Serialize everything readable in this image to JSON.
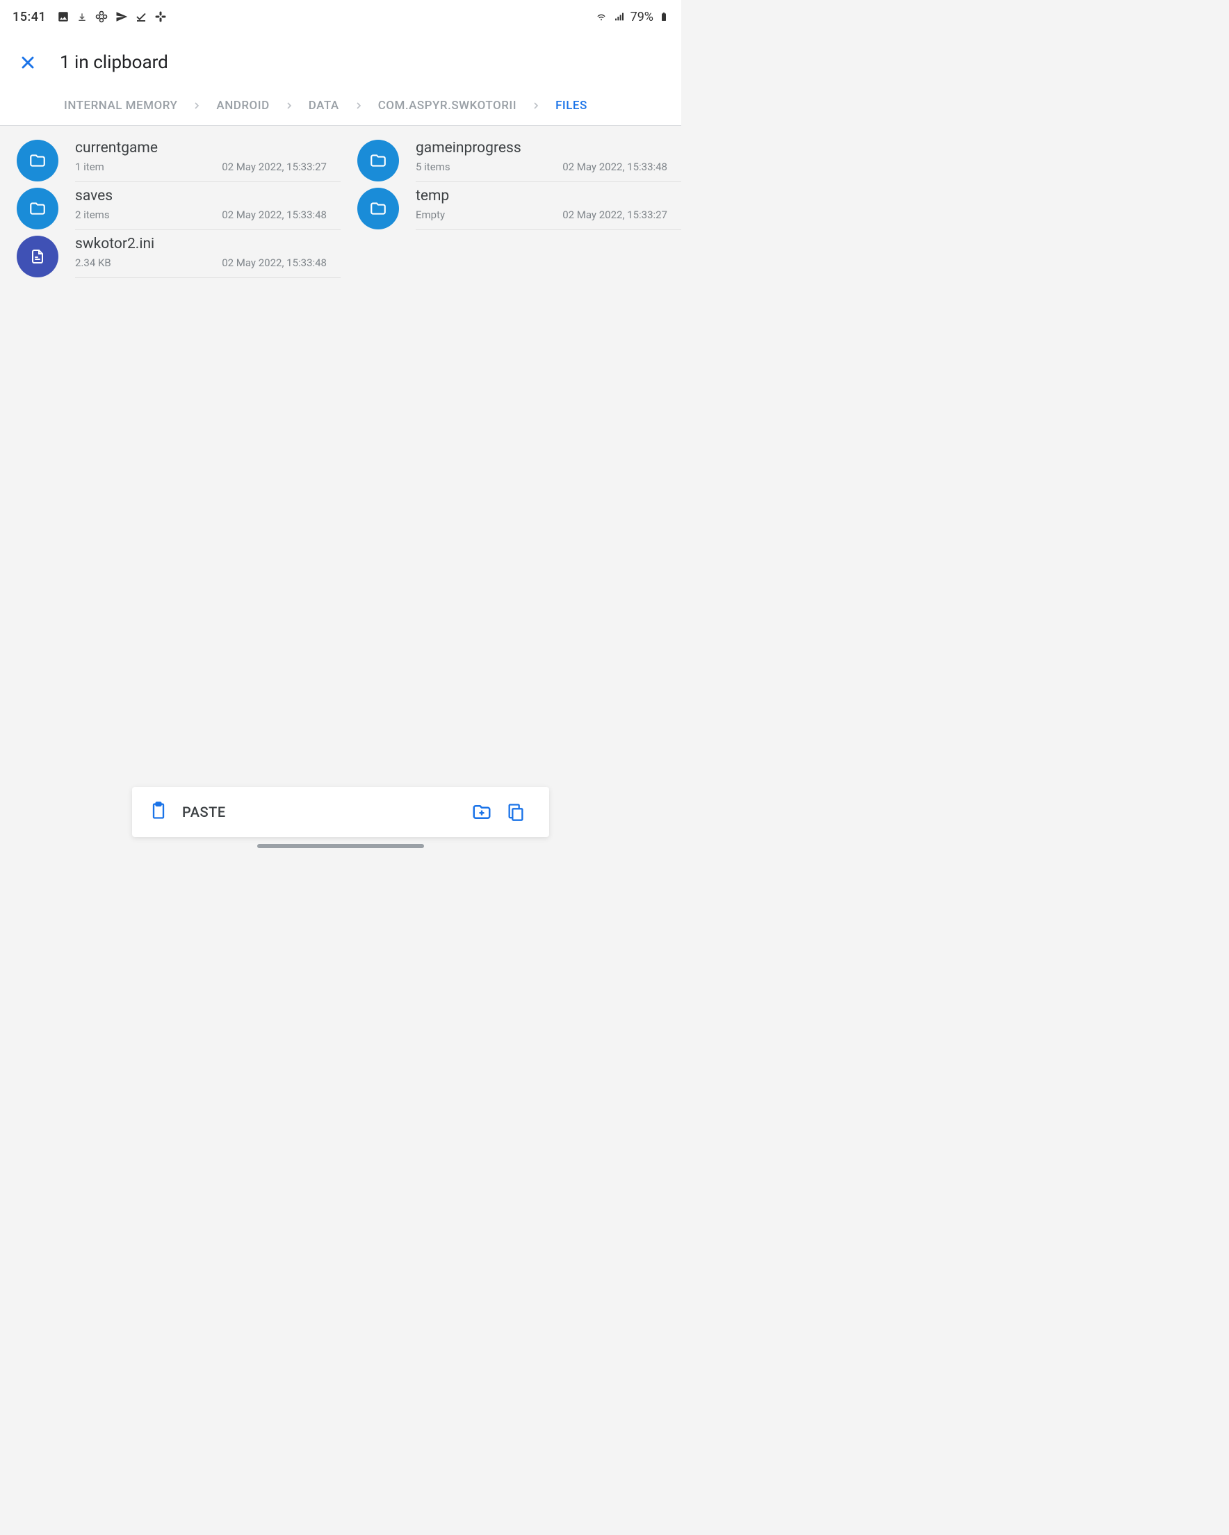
{
  "status": {
    "time": "15:41",
    "battery": "79%"
  },
  "header": {
    "title": "1 in clipboard"
  },
  "breadcrumb": [
    {
      "label": "INTERNAL MEMORY",
      "active": false
    },
    {
      "label": "ANDROID",
      "active": false
    },
    {
      "label": "DATA",
      "active": false
    },
    {
      "label": "COM.ASPYR.SWKOTORII",
      "active": false
    },
    {
      "label": "FILES",
      "active": true
    }
  ],
  "files": [
    {
      "name": "currentgame",
      "type": "folder",
      "meta": "1 item",
      "date": "02 May 2022, 15:33:27"
    },
    {
      "name": "gameinprogress",
      "type": "folder",
      "meta": "5 items",
      "date": "02 May 2022, 15:33:48"
    },
    {
      "name": "saves",
      "type": "folder",
      "meta": "2 items",
      "date": "02 May 2022, 15:33:48"
    },
    {
      "name": "temp",
      "type": "folder",
      "meta": "Empty",
      "date": "02 May 2022, 15:33:27"
    },
    {
      "name": "swkotor2.ini",
      "type": "file",
      "meta": "2.34 KB",
      "date": "02 May 2022, 15:33:48"
    }
  ],
  "actions": {
    "paste": "PASTE"
  }
}
